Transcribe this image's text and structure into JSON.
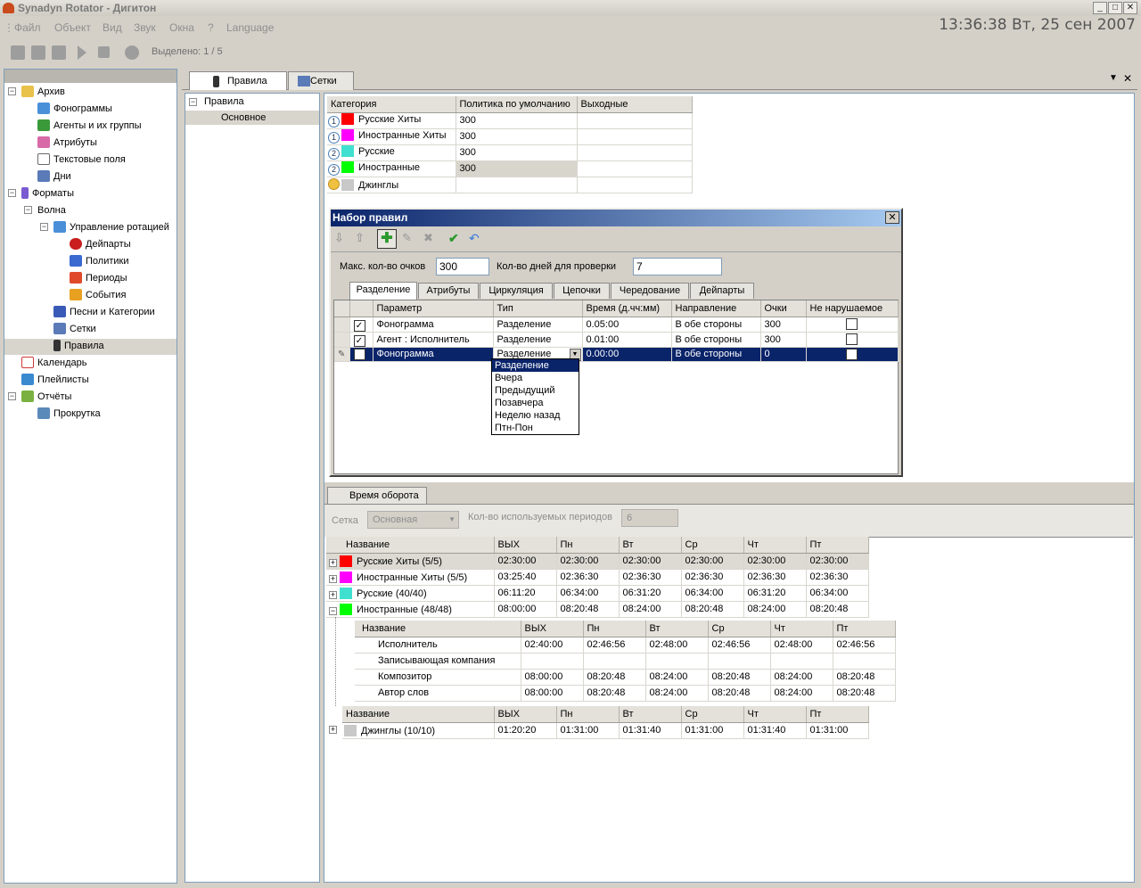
{
  "window": {
    "title": "Synadyn Rotator - Дигитон",
    "min_label": "_",
    "max_label": "□",
    "close_label": "✕"
  },
  "menu": [
    "Файл",
    "Объект",
    "Вид",
    "Звук",
    "Окна",
    "?",
    "Language"
  ],
  "clock": "13:36:38 Вт, 25 сен 2007",
  "toolbar": {
    "selected": "Выделено: 1 / 5"
  },
  "tree": [
    {
      "label": "Архив",
      "icon": "archive-icon",
      "color": "#e8c24a"
    },
    {
      "label": "Фонограммы",
      "icon": "phonogram-icon",
      "color": "#4a90d9"
    },
    {
      "label": "Агенты и их группы",
      "icon": "agents-icon",
      "color": "#3a9a3a"
    },
    {
      "label": "Атрибуты",
      "icon": "attributes-icon",
      "color": "#d86aa8"
    },
    {
      "label": "Текстовые поля",
      "icon": "text-fields-icon",
      "color": "#6a6a6a"
    },
    {
      "label": "Дни",
      "icon": "days-icon",
      "color": "#5a7ab8"
    },
    {
      "label": "Форматы",
      "icon": "formats-icon",
      "color": "#7a5ad0"
    },
    {
      "label": "Волна",
      "icon": "wave-icon",
      "color": "#ffffff"
    },
    {
      "label": "Управление ротацией",
      "icon": "rotation-icon",
      "color": "#4a8fd8"
    },
    {
      "label": "Дейпарты",
      "icon": "dayparts-icon",
      "color": "#c81e1e"
    },
    {
      "label": "Политики",
      "icon": "policies-icon",
      "color": "#3a6ad0"
    },
    {
      "label": "Периоды",
      "icon": "periods-icon",
      "color": "#e04a2a"
    },
    {
      "label": "События",
      "icon": "events-icon",
      "color": "#e8a020"
    },
    {
      "label": "Песни и Категории",
      "icon": "songs-icon",
      "color": "#3a5ab8"
    },
    {
      "label": "Сетки",
      "icon": "grids-icon",
      "color": "#5a7ab8"
    },
    {
      "label": "Правила",
      "icon": "rules-icon",
      "color": "#e8a020"
    },
    {
      "label": "Календарь",
      "icon": "calendar-icon",
      "color": "#d03a3a"
    },
    {
      "label": "Плейлисты",
      "icon": "playlists-icon",
      "color": "#3a8ad0"
    },
    {
      "label": "Отчёты",
      "icon": "reports-icon",
      "color": "#7ab040"
    },
    {
      "label": "Прокрутка",
      "icon": "scroll-icon",
      "color": "#5a8ab8"
    }
  ],
  "tabs": {
    "rules": "Правила",
    "grids": "Сетки"
  },
  "rules_tree": {
    "root": "Правила",
    "child": "Основное"
  },
  "categories": {
    "headers": [
      "Категория",
      "Политика по умолчанию",
      "Выходные"
    ],
    "rows": [
      {
        "num": "1",
        "color": "#ff0000",
        "name": "Русские Хиты",
        "policy": "300",
        "weekend": ""
      },
      {
        "num": "1",
        "color": "#ff00ff",
        "name": "Иностранные Хиты",
        "policy": "300",
        "weekend": ""
      },
      {
        "num": "2",
        "color": "#40e0d0",
        "name": "Русские",
        "policy": "300",
        "weekend": ""
      },
      {
        "num": "2",
        "color": "#00ff00",
        "name": "Иностранные",
        "policy": "300",
        "weekend": ""
      },
      {
        "num": "",
        "color": "#c8c8c8",
        "name": "Джинглы",
        "policy": "",
        "weekend": ""
      }
    ]
  },
  "dialog": {
    "title": "Набор правил",
    "max_points_label": "Макс. кол-во очков",
    "max_points_value": "300",
    "days_label": "Кол-во дней для проверки",
    "days_value": "7",
    "tabs": [
      "Разделение",
      "Атрибуты",
      "Циркуляция",
      "Цепочки",
      "Чередование",
      "Дейпарты"
    ],
    "grid_headers": [
      "Параметр",
      "Тип",
      "Время (д.чч:мм)",
      "Направление",
      "Очки",
      "Не нарушаемое"
    ],
    "rows": [
      {
        "checked": "✓",
        "param": "Фонограмма",
        "type": "Разделение",
        "time": "0.05:00",
        "dir": "В обе стороны",
        "points": "300"
      },
      {
        "checked": "✓",
        "param": "Агент : Исполнитель",
        "type": "Разделение",
        "time": "0.01:00",
        "dir": "В обе стороны",
        "points": "300"
      },
      {
        "checked": "",
        "param": "Фонограмма",
        "type": "Разделение",
        "time": "0.00:00",
        "dir": "В обе стороны",
        "points": "0"
      }
    ],
    "dropdown": [
      "Разделение",
      "Вчера",
      "Предыдущий",
      "Позавчера",
      "Неделю назад",
      "Птн-Пон"
    ]
  },
  "turnover": {
    "tab": "Время оборота",
    "grid_label": "Сетка",
    "grid_value": "Основная",
    "periods_label": "Кол-во используемых периодов",
    "periods_value": "6",
    "headers": [
      "Название",
      "ВЫХ",
      "Пн",
      "Вт",
      "Ср",
      "Чт",
      "Пт"
    ],
    "rows": [
      {
        "exp": "+",
        "color": "#ff0000",
        "name": "Русские Хиты (5/5)",
        "v": [
          "02:30:00",
          "02:30:00",
          "02:30:00",
          "02:30:00",
          "02:30:00",
          "02:30:00"
        ]
      },
      {
        "exp": "+",
        "color": "#ff00ff",
        "name": "Иностранные Хиты (5/5)",
        "v": [
          "03:25:40",
          "02:36:30",
          "02:36:30",
          "02:36:30",
          "02:36:30",
          "02:36:30"
        ]
      },
      {
        "exp": "+",
        "color": "#40e0d0",
        "name": "Русские (40/40)",
        "v": [
          "06:11:20",
          "06:34:00",
          "06:31:20",
          "06:34:00",
          "06:31:20",
          "06:34:00"
        ]
      },
      {
        "exp": "−",
        "color": "#00ff00",
        "name": "Иностранные (48/48)",
        "v": [
          "08:00:00",
          "08:20:48",
          "08:24:00",
          "08:20:48",
          "08:24:00",
          "08:20:48"
        ]
      }
    ],
    "sub_headers": [
      "Название",
      "ВЫХ",
      "Пн",
      "Вт",
      "Ср",
      "Чт",
      "Пт"
    ],
    "sub_rows": [
      {
        "name": "Исполнитель",
        "v": [
          "02:40:00",
          "02:46:56",
          "02:48:00",
          "02:46:56",
          "02:48:00",
          "02:46:56"
        ]
      },
      {
        "name": "Записывающая компания",
        "v": [
          "",
          "",
          "",
          "",
          "",
          ""
        ]
      },
      {
        "name": "Композитор",
        "v": [
          "08:00:00",
          "08:20:48",
          "08:24:00",
          "08:20:48",
          "08:24:00",
          "08:20:48"
        ]
      },
      {
        "name": "Автор слов",
        "v": [
          "08:00:00",
          "08:20:48",
          "08:24:00",
          "08:20:48",
          "08:24:00",
          "08:20:48"
        ]
      }
    ],
    "headers2": [
      "Название",
      "ВЫХ",
      "Пн",
      "Вт",
      "Ср",
      "Чт",
      "Пт"
    ],
    "jingles": {
      "exp": "+",
      "color": "#c8c8c8",
      "name": "Джинглы (10/10)",
      "v": [
        "01:20:20",
        "01:31:00",
        "01:31:40",
        "01:31:00",
        "01:31:40",
        "01:31:00"
      ]
    }
  }
}
